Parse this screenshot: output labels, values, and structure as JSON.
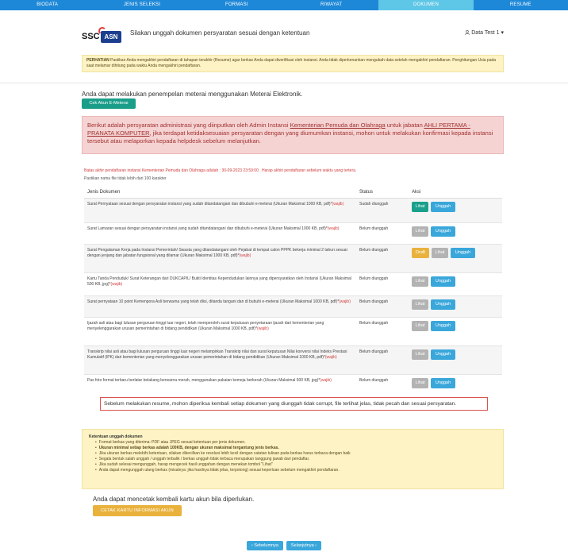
{
  "nav": {
    "tabs": [
      {
        "label": "BIODATA"
      },
      {
        "label": "JENIS SELEKSI"
      },
      {
        "label": "FORMASI"
      },
      {
        "label": "RIWAYAT"
      },
      {
        "label": "DOKUMEN"
      },
      {
        "label": "RESUME"
      }
    ],
    "active": 4
  },
  "header": {
    "logo_left": "SSC",
    "logo_right": "ASN",
    "title": "Silakan unggah dokumen persyaratan sesuai dengan ketentuan",
    "user": "Data Test 1 ▾"
  },
  "notice": {
    "label": "PERHATIAN",
    "text": " Pastikan Anda mengakhiri pendaftaran di tahapan terakhir (Resume) agar berkas Anda dapat diverifikasi oleh instansi. Anda tidak diperkenankan mengubah data setelah mengakhiri pendaftaran. Penghitungan Usia pada saat melamar dihitung pada waktu Anda mengakhiri pendaftaran."
  },
  "meterai": {
    "text": "Anda dapat melakukan penempelan meterai menggunakan Meterai Elektronik.",
    "button": "Cek Akun E-Meterai"
  },
  "info": {
    "part1": "Berikut adalah persyaratan administrasi yang diinputkan oleh Admin Instansi ",
    "instansi": "Kementerian Pemuda dan Olahraga",
    "part2": " untuk jabatan ",
    "jabatan": "AHLI PERTAMA - PRANATA KOMPUTER",
    "part3": ", jika terdapat ketidaksesuaian persyaratan dengan yang diumumkan instansi, mohon untuk melakukan konfirmasi kepada instansi tersebut atau melaporkan kepada helpdesk sebelum melanjutkan."
  },
  "deadline": "Batas akhir pendaftaran instansi Kementerian Pemuda dan Olahraga adalah : 30-09-2023 23:59:00 . Harap akhiri pendaftaran sebelum waktu yang tertera.",
  "filename_note": "Pastikan nama file tidak lebih dari 100 karakter",
  "table": {
    "headers": [
      "Jenis Dokumen",
      "Status",
      "Aksi"
    ],
    "req_label": "(wajib)",
    "btn_lihat": "Lihat",
    "btn_unggah": "Unggah",
    "btn_draft": "Draft",
    "rows": [
      {
        "doc": "Surat Pernyataan sesuai dengan persyaratan instansi yang sudah ditandatangani dan dibubuhi e-meterai (Ukuran Maksimal 1000 KB, pdf)*",
        "status": "Sudah diunggah"
      },
      {
        "doc": "Surat Lamaran sesuai dengan persyaratan instansi yang sudah ditandatangani dan dibubuhi e-meterai (Ukuran Maksimal 1000 KB, pdf)*",
        "status": "Belum diunggah"
      },
      {
        "doc": "Surat Pengalaman Kerja pada Instansi Pemerintah/ Swasta yang ditandatangani oleh Pejabat di tempat calon PPPK bekerja minimal 2 tahun sesuai dengan jenjang dan jabatan fungsional yang dilamar (Ukuran Maksimal 1000 KB, pdf)*",
        "status": "Belum diunggah"
      },
      {
        "doc": "Kartu Tanda Penduduk/ Surat Keterangan dari DUKCAPIL/ Bukti Identitas Kependudukan lainnya yang dipersyaratkan oleh Instansi (Ukuran Maksimal 500 KB, jpg)*",
        "status": "Belum diunggah"
      },
      {
        "doc": "Surat pernyataan 10 point Kemenpora Asli berwarna yang telah diisi, ditanda tangani dan di bubuhi e-meterai (Ukuran Maksimal 1000 KB, pdf)*",
        "status": "Belum diunggah"
      },
      {
        "doc": "Ijazah asli atau bagi lulusan perguruan tinggi luar negeri, telah memperoleh surat keputusan penyetaraan ijazah dari kementerian yang menyelenggarakan urusan pemerintahan di bidang pendidikan (Ukuran Maksimal 1000 KB, pdf)*",
        "status": "Belum diunggah"
      },
      {
        "doc": "Transkrip nilai asli atau bagi lulusan perguruan tinggi luar negeri melampirkan Transkrip nilai dan surat keputusan Nilai konversi nilai Indeks Prestasi Kumulatif (IPK) dari kementerian yang menyelenggarakan urusan pemerintahan di bidang pendidikan (Ukuran Maksimal 1000 KB, pdf)*",
        "status": "Belum diunggah"
      },
      {
        "doc": "Pas foto formal terbaru berlatar belakang berwarna merah, menggunakan pakaian kemeja berkerah (Ukuran Maksimal 500 KB, jpg)*",
        "status": "Belum diunggah"
      }
    ]
  },
  "warning": "Sebelum melakukan resume, mohon diperiksa kembali setiap dokumen yang diunggah tidak corrupt, file terlihat jelas, tidak pecah dan sesuai persyaratan.",
  "ketentuan": {
    "title": "Ketentuan unggah dokumen",
    "items": [
      "Format berkas yang diterima: PDF atau JPEG sesuai ketentuan per jenis dokumen.",
      "Ukuran minimal setiap berkas adalah 100KB, dengan ukuran maksimal tergantung jenis berkas.",
      "Jika ukuran berkas melebihi ketentuan, silakan dikecilkan ke resolusi lebih kecil dengan catatan tulisan pada berkas harus terbaca dengan baik",
      "Segala bentuk salah unggah / unggah terbalik / berkas unggah tidak terbaca merupakan tanggung jawab dari pendaftar.",
      "Jika sudah selesai mengunggah, harap mengecek hasil unggahan dengan menekan tombol \"Lihat\"",
      "Anda dapat mengunggah ulang berkas (misalnya: jika hasilnya tidak jelas, terpotong) sesuai keperluan sebelum mengakhiri pendaftaran."
    ]
  },
  "cetak": {
    "text": "Anda dapat mencetak kembali kartu akun bila diperlukan.",
    "button": "CETAK KARTU INFORMASI AKUN"
  },
  "pager": {
    "prev": "‹ Sebelumnya",
    "next": "Selanjutnya ›"
  }
}
